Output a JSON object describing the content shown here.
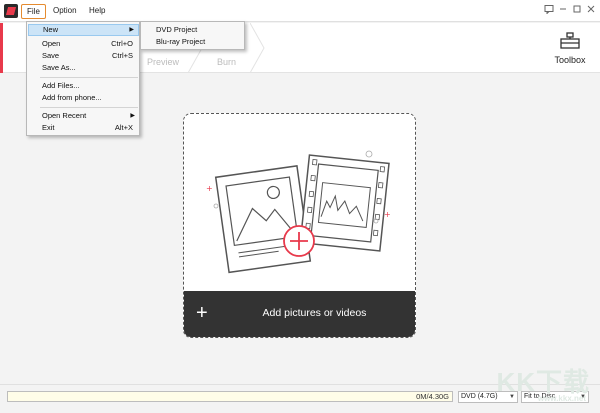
{
  "menubar": {
    "file": "File",
    "option": "Option",
    "help": "Help"
  },
  "file_menu": {
    "items": [
      {
        "label": "New",
        "shortcut": "",
        "submenu": true
      },
      {
        "label": "Open",
        "shortcut": "Ctrl+O"
      },
      {
        "label": "Save",
        "shortcut": "Ctrl+S"
      },
      {
        "label": "Save As...",
        "shortcut": ""
      },
      {
        "label": "Add Files...",
        "shortcut": ""
      },
      {
        "label": "Add from phone...",
        "shortcut": ""
      },
      {
        "label": "Open Recent",
        "shortcut": "",
        "submenu": true
      },
      {
        "label": "Exit",
        "shortcut": "Alt+X"
      }
    ]
  },
  "new_submenu": {
    "items": [
      "DVD Project",
      "Blu-ray Project"
    ]
  },
  "steps": {
    "preview": "Preview",
    "burn": "Burn"
  },
  "toolbox": {
    "label": "Toolbox",
    "icon": "toolbox-icon"
  },
  "dropzone": {
    "label": "Add pictures or videos",
    "icon": "plus-icon"
  },
  "status": {
    "capacity": "0M/4.30G",
    "disc_type": "DVD (4.7G)",
    "fit_mode": "Fit to Disc"
  },
  "watermark": {
    "text": "KK下载",
    "url": "www.kkx.net"
  },
  "colors": {
    "accent": "#e8394b",
    "menu_highlight": "#cce4f7",
    "dropzone_bar": "#333333"
  }
}
